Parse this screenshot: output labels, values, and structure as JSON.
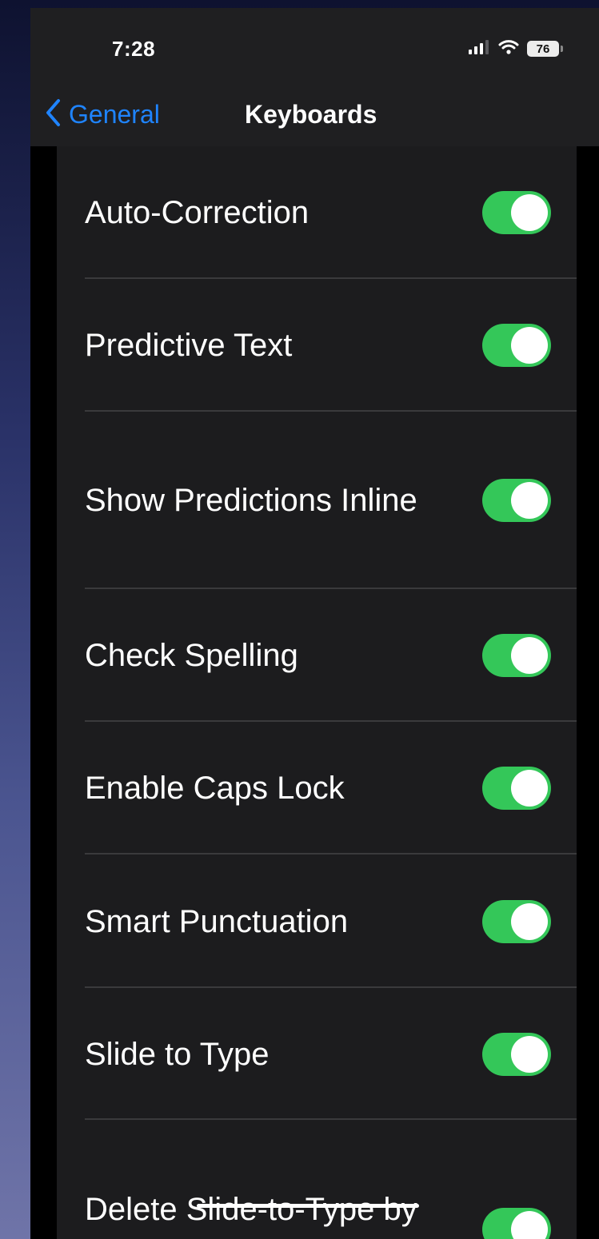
{
  "status_bar": {
    "time": "7:28",
    "battery_level": "76",
    "icons": [
      "signal-icon",
      "wifi-icon",
      "battery-icon"
    ]
  },
  "nav": {
    "back_label": "General",
    "title": "Keyboards",
    "accent_color": "#1f84ff"
  },
  "settings": {
    "toggle_on_color": "#34c759",
    "items": [
      {
        "label": "Auto-Correction",
        "enabled": true
      },
      {
        "label": "Predictive Text",
        "enabled": true
      },
      {
        "label": "Show Predictions Inline",
        "enabled": true
      },
      {
        "label": "Check Spelling",
        "enabled": true
      },
      {
        "label": "Enable Caps Lock",
        "enabled": true
      },
      {
        "label": "Smart Punctuation",
        "enabled": true
      },
      {
        "label": "Slide to Type",
        "enabled": true
      },
      {
        "label": "Delete Slide-to-Type by Word",
        "enabled": true
      }
    ]
  }
}
